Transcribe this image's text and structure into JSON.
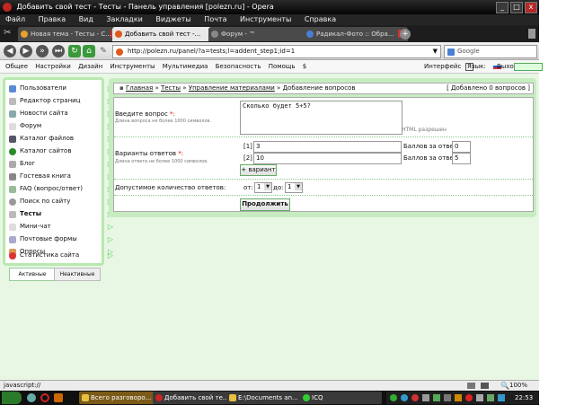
{
  "window": {
    "title": "Добавить свой тест - Тесты - Панель управления [polezn.ru] - Opera",
    "controls": [
      "_",
      "□",
      "x"
    ]
  },
  "menu": [
    "Файл",
    "Правка",
    "Вид",
    "Закладки",
    "Виджеты",
    "Почта",
    "Инструменты",
    "Справка"
  ],
  "tabs": [
    "Новая тема - Тесты - С...",
    "Добавить свой тест -...",
    "Форум - ™",
    "Радикал-Фото :: Обра..."
  ],
  "address": {
    "url": "http://polezn.ru/panel/?a=tests;l=addent_step1;id=1",
    "search_placeholder": "Google"
  },
  "sitebar": {
    "left": [
      "Общее",
      "Настройки",
      "Дизайн",
      "Инструменты",
      "Мультимедиа",
      "Безопасность",
      "Помощь",
      "$"
    ],
    "right": [
      "Интерфейс",
      "Язык:",
      "Выход"
    ]
  },
  "sidebar": {
    "items": [
      "Пользователи",
      "Редактор страниц",
      "Новости сайта",
      "Форум",
      "Каталог файлов",
      "Каталог сайтов",
      "Блог",
      "Гостевая книга",
      "FAQ (вопрос/ответ)",
      "Поиск по сайту",
      "Тесты",
      "Мини-чат",
      "Почтовые формы",
      "Опросы",
      "Статистика сайта"
    ],
    "tabs": [
      "Активные",
      "Неактивные"
    ]
  },
  "breadcrumb": [
    "Главная",
    "»",
    "Тесты",
    "»",
    "Управление материалами",
    "»",
    "Добавление вопросов"
  ],
  "added_count": "[ Добавлено 0 вопросов ]",
  "form": {
    "question_label": "Введите вопрос",
    "required_mark": "*:",
    "question_hint": "Длина вопроса не более 1000 символов.",
    "question_value": "Сколько будет 5+5?",
    "html_allowed": "HTML разрешен",
    "answers_label": "Варианты ответов",
    "answers_hint": "Длина ответа не более 1000 символов.",
    "answers": [
      {
        "index": "[1]",
        "value": "3",
        "points_label": "Баллов за ответ:",
        "points": "0"
      },
      {
        "index": "[2]",
        "value": "10",
        "points_label": "Баллов за ответ:",
        "points": "5"
      }
    ],
    "add_variant": "+ вариант",
    "allowed_label": "Допустимое количество ответов:",
    "from_label": "от:",
    "from_value": "1",
    "to_label": "до:",
    "to_value": "1",
    "continue": "Продолжить"
  },
  "status": {
    "text": "javascript://",
    "zoom": "100%"
  },
  "taskbar": {
    "buttons": [
      "Всего разговоро...",
      "Добавить свой те...",
      "E:\\Documents an...",
      "ICQ"
    ],
    "time": "22:53"
  }
}
